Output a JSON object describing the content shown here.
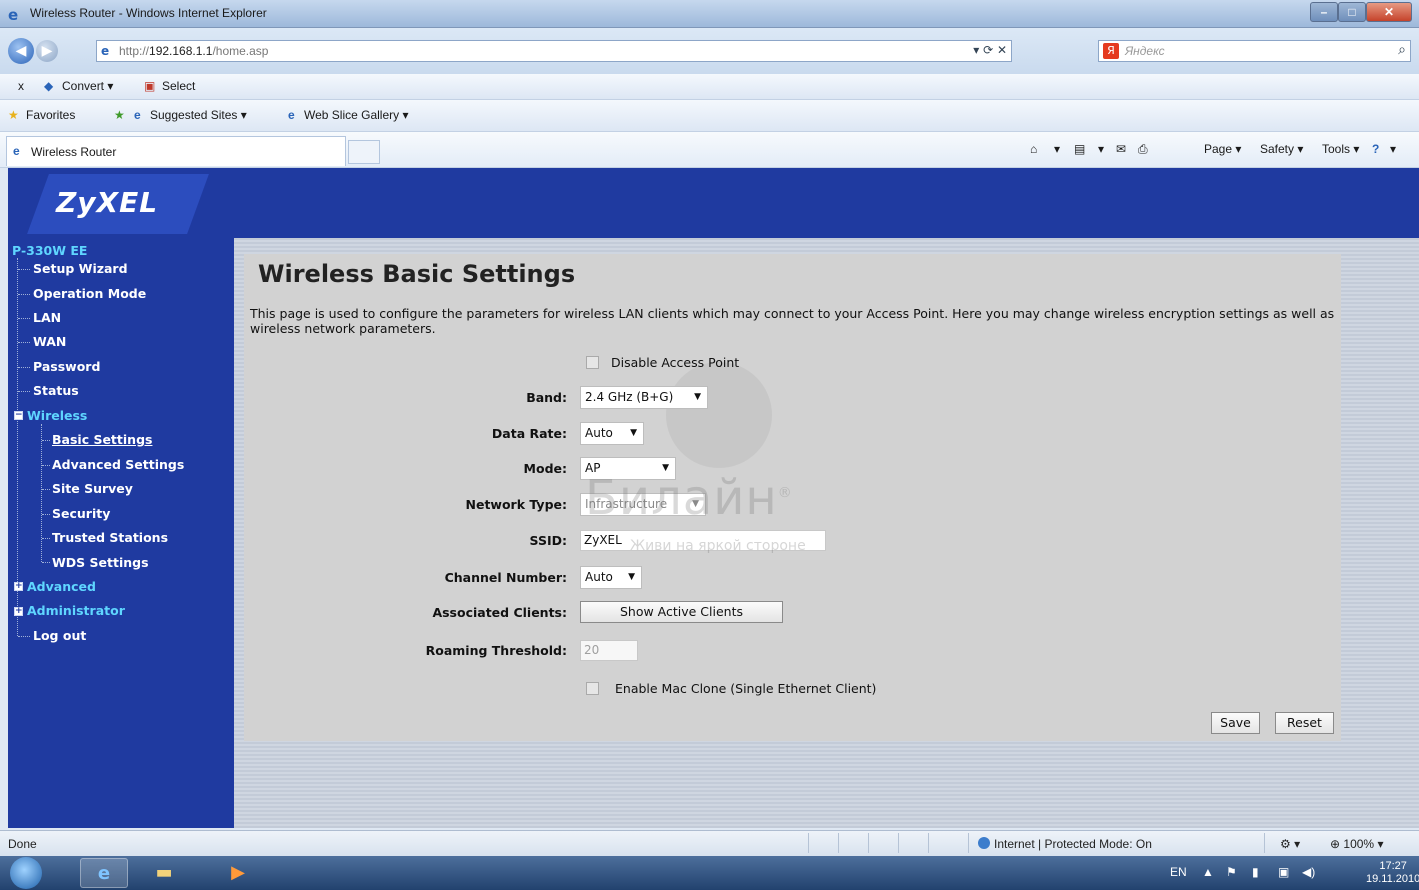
{
  "window": {
    "title": "Wireless Router - Windows Internet Explorer",
    "min_icon": "minimize-icon",
    "max_icon": "maximize-icon",
    "close_icon": "close-icon"
  },
  "address_bar": {
    "url_prefix": "http://",
    "url_host": "192.168.1.1",
    "url_path": "/home.asp",
    "search_placeholder": "Яндекс"
  },
  "toolbar1": {
    "close": "x",
    "convert": "Convert ▾",
    "select": "Select"
  },
  "toolbar2": {
    "favorites": "Favorites",
    "suggested": "Suggested Sites ▾",
    "webslice": "Web Slice Gallery ▾"
  },
  "toolbar3": {
    "tab_title": "Wireless Router",
    "home": "▾",
    "feeds": "▾",
    "page": "Page ▾",
    "safety": "Safety ▾",
    "tools": "Tools ▾",
    "help": "▾"
  },
  "router": {
    "brand": "ZyXEL",
    "nav": {
      "model": "P-330W EE",
      "items": [
        "Setup Wizard",
        "Operation Mode",
        "LAN",
        "WAN",
        "Password",
        "Status",
        "Wireless",
        "Basic Settings",
        "Advanced Settings",
        "Site Survey",
        "Security",
        "Trusted Stations",
        "WDS Settings",
        "Advanced",
        "Administrator",
        "Log out"
      ]
    },
    "page": {
      "title": "Wireless Basic Settings",
      "description": "This page is used to configure the parameters for wireless LAN clients which may connect to your Access Point. Here you may change wireless encryption settings as well as wireless network parameters.",
      "disable_ap_label": "Disable Access Point",
      "band": {
        "label": "Band:",
        "value": "2.4 GHz (B+G)"
      },
      "data_rate": {
        "label": "Data Rate:",
        "value": "Auto"
      },
      "mode": {
        "label": "Mode:",
        "value": "AP"
      },
      "network_type": {
        "label": "Network Type:",
        "value": "Infrastructure"
      },
      "ssid": {
        "label": "SSID:",
        "value": "ZyXEL"
      },
      "channel": {
        "label": "Channel Number:",
        "value": "Auto"
      },
      "assoc_clients": {
        "label": "Associated Clients:",
        "button": "Show Active Clients"
      },
      "roaming": {
        "label": "Roaming Threshold:",
        "value": "20"
      },
      "mac_clone_label": "Enable Mac Clone (Single Ethernet Client)",
      "save": "Save",
      "reset": "Reset"
    },
    "watermark": {
      "brand": "Билайн",
      "reg": "®",
      "slogan": "Живи на яркой стороне"
    }
  },
  "statusbar": {
    "done": "Done",
    "zone": "Internet | Protected Mode: On",
    "zoom": "100%",
    "zoom_arrow": "▾"
  },
  "taskbar": {
    "lang": "EN",
    "time": "17:27",
    "date": "19.11.2010"
  },
  "colors": {
    "router_blue": "#1f3aa0",
    "nav_accent": "#5fd6ff",
    "panel_grey": "#d2d2d2"
  }
}
